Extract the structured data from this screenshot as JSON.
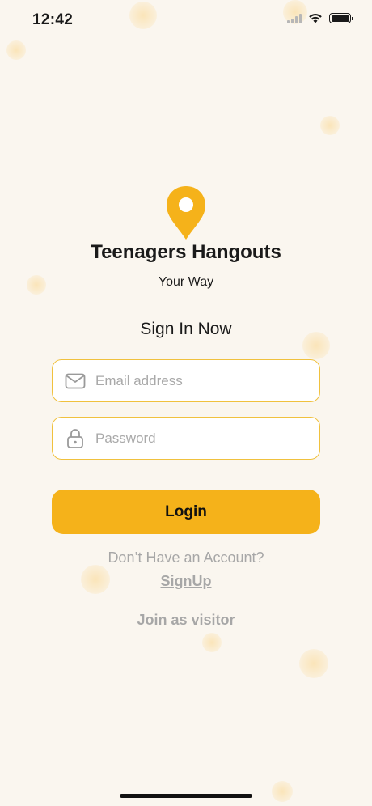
{
  "status_bar": {
    "time": "12:42",
    "icons": [
      "cellular-signal-icon",
      "wifi-icon",
      "battery-icon"
    ]
  },
  "brand": {
    "logo_icon": "location-pin-icon",
    "title": "Teenagers Hangouts",
    "subtitle": "Your Way",
    "accent_color": "#F5B21A"
  },
  "form": {
    "heading": "Sign In Now",
    "email": {
      "placeholder": "Email address",
      "value": "",
      "icon": "envelope-icon"
    },
    "password": {
      "placeholder": "Password",
      "value": "",
      "icon": "lock-icon"
    },
    "login_label": "Login"
  },
  "footer": {
    "no_account_text": "Don’t Have an Account?",
    "signup_label": "SignUp",
    "visitor_label": "Join as visitor"
  },
  "colors": {
    "background": "#FAF6EF",
    "field_border": "#F0C13E",
    "muted_text": "#A7A7A7"
  }
}
